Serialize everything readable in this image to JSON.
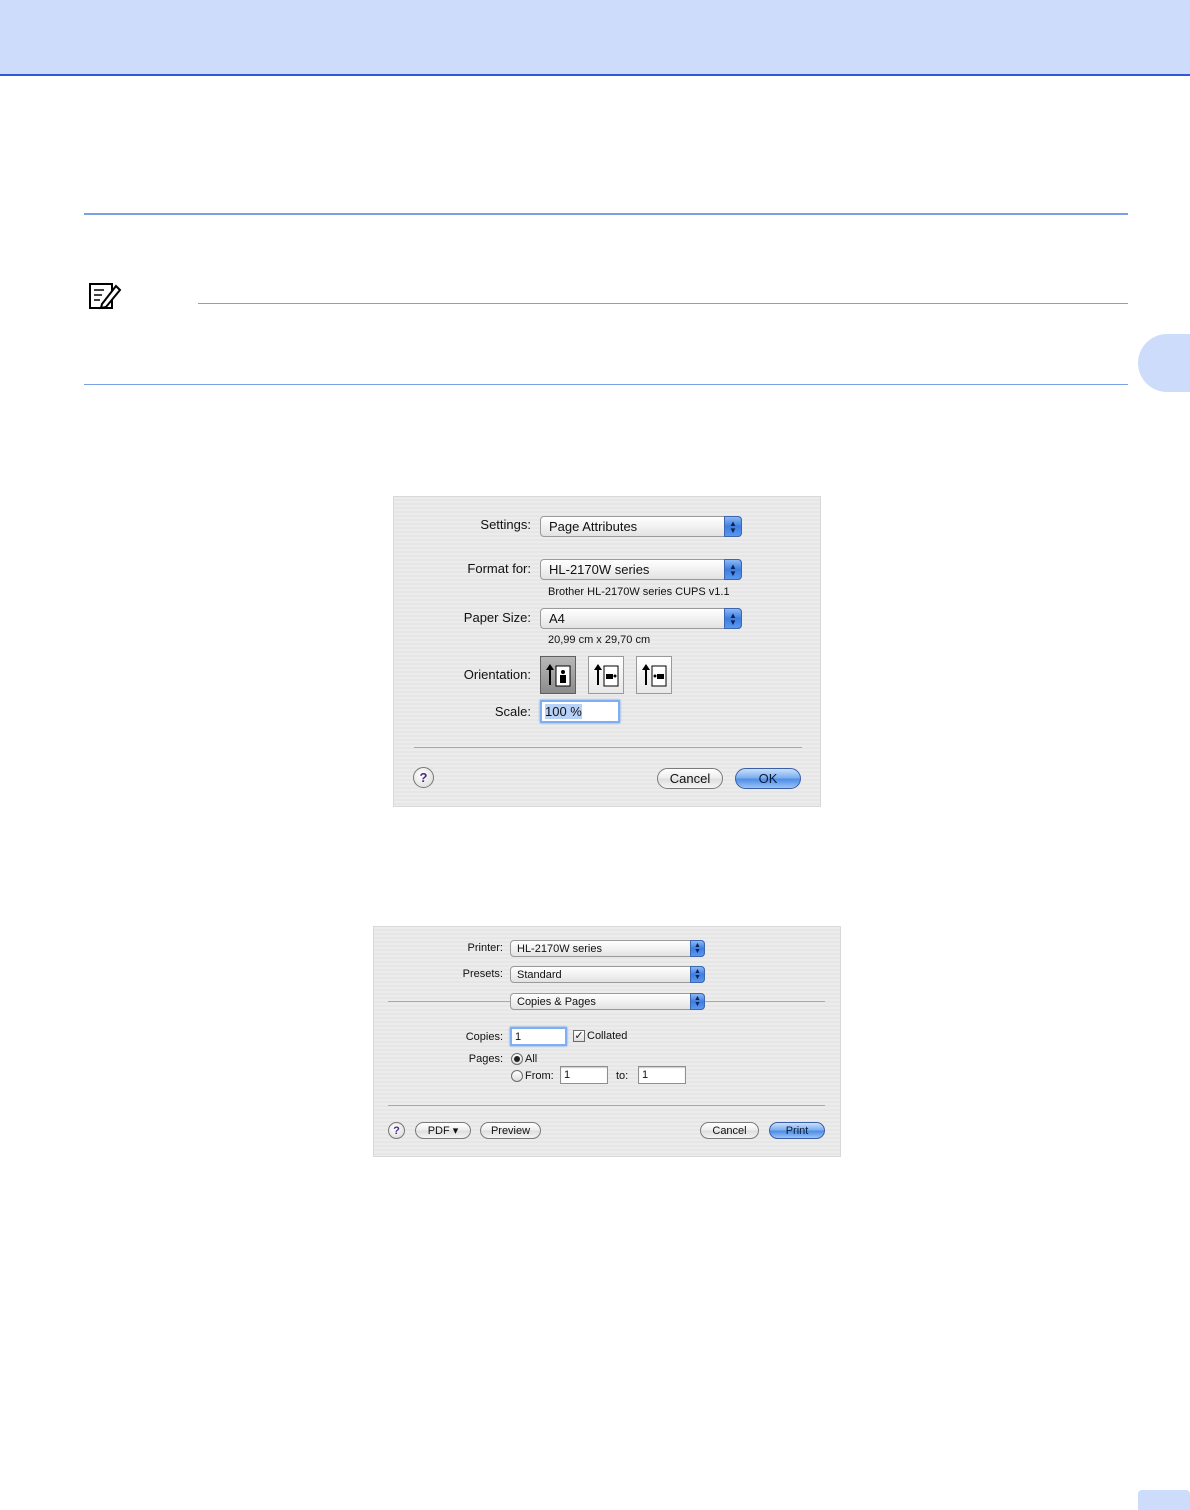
{
  "page_setup": {
    "settings_label": "Settings:",
    "settings_value": "Page Attributes",
    "format_for_label": "Format for:",
    "format_for_value": "HL-2170W series",
    "format_for_desc": "Brother HL-2170W series CUPS v1.1",
    "paper_size_label": "Paper Size:",
    "paper_size_value": "A4",
    "paper_size_desc": "20,99 cm x 29,70 cm",
    "orientation_label": "Orientation:",
    "scale_label": "Scale:",
    "scale_value": "100 %",
    "help": "?",
    "cancel": "Cancel",
    "ok": "OK"
  },
  "print_dialog": {
    "printer_label": "Printer:",
    "printer_value": "HL-2170W series",
    "presets_label": "Presets:",
    "presets_value": "Standard",
    "panel_value": "Copies & Pages",
    "copies_label": "Copies:",
    "copies_value": "1",
    "collated_label": "Collated",
    "pages_label": "Pages:",
    "all_label": "All",
    "from_label": "From:",
    "from_value": "1",
    "to_label": "to:",
    "to_value": "1",
    "help": "?",
    "pdf": "PDF ▾",
    "preview": "Preview",
    "cancel": "Cancel",
    "print": "Print"
  },
  "colors": {
    "band": "#cddcfb",
    "accent_line": "#2e5ad8",
    "rule": "#7aa0e8"
  }
}
